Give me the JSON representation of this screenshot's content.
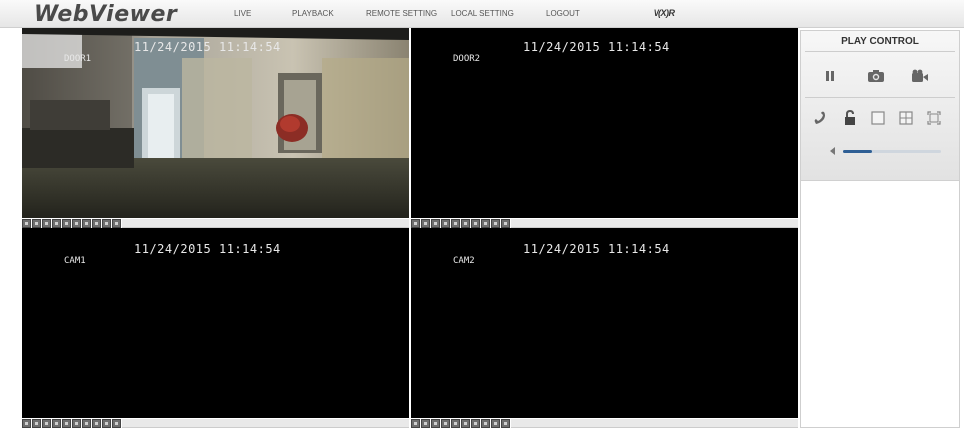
{
  "app": {
    "logo": "WebViewer"
  },
  "nav": {
    "items": [
      "LIVE",
      "PLAYBACK",
      "REMOTE SETTING",
      "LOCAL SETTING",
      "LOGOUT"
    ],
    "vendor": "\\/(X)R"
  },
  "cameras": [
    {
      "name": "DOOR1",
      "timestamp": "11/24/2015 11:14:54"
    },
    {
      "name": "DOOR2",
      "timestamp": "11/24/2015 11:14:54"
    },
    {
      "name": "CAM1",
      "timestamp": "11/24/2015 11:14:54"
    },
    {
      "name": "CAM2",
      "timestamp": "11/24/2015 11:14:54"
    }
  ],
  "panel": {
    "title": "PLAY CONTROL",
    "icons": [
      "pause-icon",
      "snapshot-icon",
      "record-icon",
      "talk-icon",
      "lock-icon",
      "single-view-icon",
      "quad-view-icon",
      "fullscreen-icon",
      "volume-icon"
    ],
    "volume_level": 0.3
  },
  "colors": {
    "accent": "#2f5f95",
    "video_bg": "#000000"
  }
}
